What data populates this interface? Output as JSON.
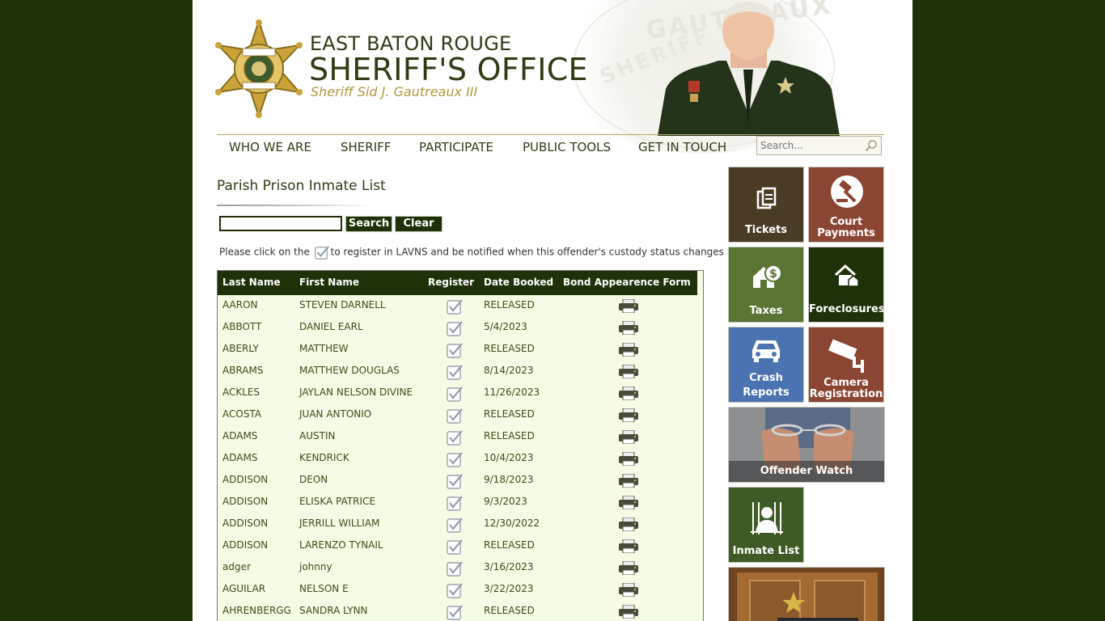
{
  "header": {
    "line1": "EAST BATON ROUGE",
    "line2": "SHERIFF'S OFFICE",
    "line3": "Sheriff Sid J. Gautreaux III",
    "watermark1": "GAUTREAUX",
    "watermark2": "SHERIFF"
  },
  "nav": {
    "items": [
      "WHO WE ARE",
      "SHERIFF",
      "PARTICIPATE",
      "PUBLIC TOOLS",
      "GET IN TOUCH"
    ],
    "search_placeholder": "Search..."
  },
  "main": {
    "title": "Parish Prison Inmate List",
    "search_label": "Search",
    "clear_label": "Clear",
    "note_before": "Please click on the",
    "note_after": "to register in LAVNS and be notified when this offender's custody status changes"
  },
  "table": {
    "headers": [
      "Last Name",
      "First Name",
      "Register",
      "Date Booked",
      "Bond Appearence Form"
    ],
    "rows": [
      {
        "last": "AARON",
        "first": "STEVEN DARNELL",
        "date": "RELEASED"
      },
      {
        "last": "ABBOTT",
        "first": "DANIEL EARL",
        "date": "5/4/2023"
      },
      {
        "last": "ABERLY",
        "first": "MATTHEW",
        "date": "RELEASED"
      },
      {
        "last": "ABRAMS",
        "first": "MATTHEW DOUGLAS",
        "date": "8/14/2023"
      },
      {
        "last": "ACKLES",
        "first": "JAYLAN NELSON DIVINE",
        "date": "11/26/2023"
      },
      {
        "last": "ACOSTA",
        "first": "JUAN ANTONIO",
        "date": "RELEASED"
      },
      {
        "last": "ADAMS",
        "first": "AUSTIN",
        "date": "RELEASED"
      },
      {
        "last": "ADAMS",
        "first": "KENDRICK",
        "date": "10/4/2023"
      },
      {
        "last": "ADDISON",
        "first": "DEON",
        "date": "9/18/2023"
      },
      {
        "last": "ADDISON",
        "first": "ELISKA PATRICE",
        "date": "9/3/2023"
      },
      {
        "last": "ADDISON",
        "first": "JERRILL WILLIAM",
        "date": "12/30/2022"
      },
      {
        "last": "ADDISON",
        "first": "LARENZO TYNAIL",
        "date": "RELEASED"
      },
      {
        "last": "adger",
        "first": "johnny",
        "date": "3/16/2023"
      },
      {
        "last": "AGUILAR",
        "first": "NELSON E",
        "date": "3/22/2023"
      },
      {
        "last": "AHRENBERGG",
        "first": "SANDRA LYNN",
        "date": "RELEASED"
      }
    ]
  },
  "tiles": {
    "tickets": "Tickets",
    "court_payments_1": "Court",
    "court_payments_2": "Payments",
    "taxes": "Taxes",
    "foreclosures": "Foreclosures",
    "crash_1": "Crash",
    "crash_2": "Reports",
    "camera_1": "Camera",
    "camera_2": "Registration",
    "offender": "Offender Watch",
    "inmate": "Inmate List"
  }
}
